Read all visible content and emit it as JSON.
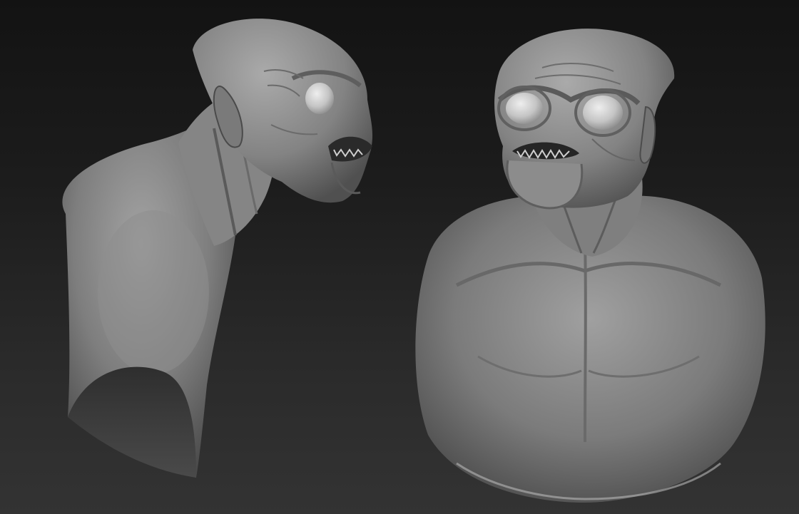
{
  "viewport": {
    "background_top": "#131313",
    "background_bottom": "#333333",
    "material_color": "#8a8a8a"
  },
  "sculpts": [
    {
      "view": "side-view",
      "subject": "creature-bust"
    },
    {
      "view": "front-view",
      "subject": "creature-bust"
    }
  ]
}
